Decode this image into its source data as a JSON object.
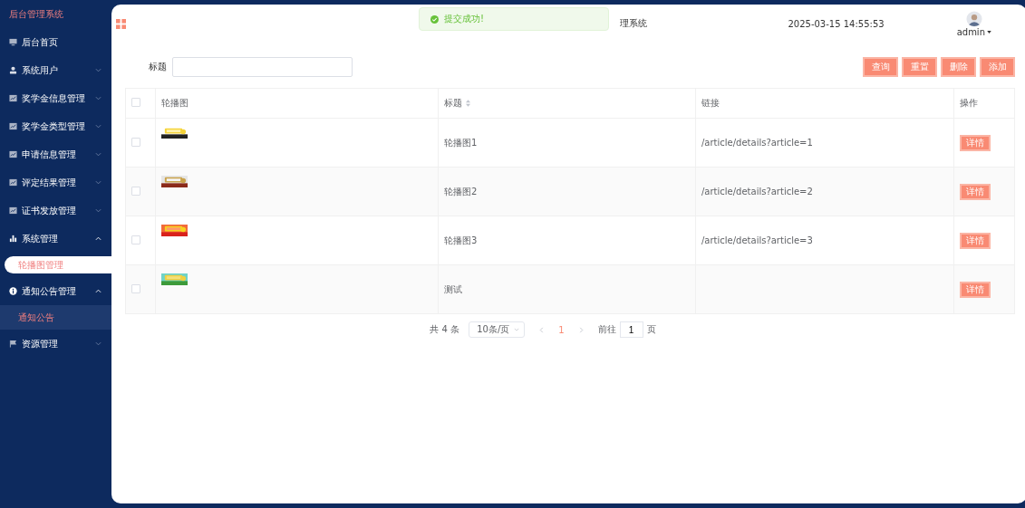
{
  "sidebar": {
    "brand": "后台管理系统",
    "items": [
      {
        "label": "后台首页"
      },
      {
        "label": "系统用户",
        "expanded": false
      },
      {
        "label": "奖学金信息管理",
        "expanded": false
      },
      {
        "label": "奖学金类型管理",
        "expanded": false
      },
      {
        "label": "申请信息管理",
        "expanded": false
      },
      {
        "label": "评定结果管理",
        "expanded": false
      },
      {
        "label": "证书发放管理",
        "expanded": false
      },
      {
        "label": "系统管理",
        "expanded": true,
        "children": [
          {
            "label": "轮播图管理",
            "selected": true,
            "hovered": false
          }
        ]
      },
      {
        "label": "通知公告管理",
        "expanded": true,
        "children": [
          {
            "label": "通知公告",
            "selected": false,
            "hovered": true
          }
        ]
      },
      {
        "label": "资源管理",
        "expanded": false
      }
    ]
  },
  "header": {
    "title": "理系统",
    "datetime": "2025-03-15 14:55:53",
    "user": "admin"
  },
  "toast": {
    "message": "提交成功!"
  },
  "search": {
    "label": "标题"
  },
  "buttons": [
    "查询",
    "重置",
    "删除",
    "添加"
  ],
  "table": {
    "all_checked": false,
    "columns": [
      {
        "label": "轮播图",
        "sortable": false
      },
      {
        "label": "标题",
        "sortable": true
      },
      {
        "label": "链接",
        "sortable": false
      },
      {
        "label": "操作",
        "sortable": false
      }
    ],
    "rows": [
      {
        "checked": false,
        "title": "轮播图1",
        "link": "/article/details?article=1",
        "action": "详情"
      },
      {
        "checked": false,
        "title": "轮播图2",
        "link": "/article/details?article=2",
        "action": "详情"
      },
      {
        "checked": false,
        "title": "轮播图3",
        "link": "/article/details?article=3",
        "action": "详情"
      },
      {
        "checked": false,
        "title": "测试",
        "link": "",
        "action": "详情"
      }
    ]
  },
  "pagination": {
    "total": "共 4 条",
    "page_size": "10条/页",
    "pages": [
      {
        "label": "1",
        "selected": true
      }
    ],
    "goto_label": "前往",
    "goto_value": "1",
    "goto_suffix": "页"
  }
}
